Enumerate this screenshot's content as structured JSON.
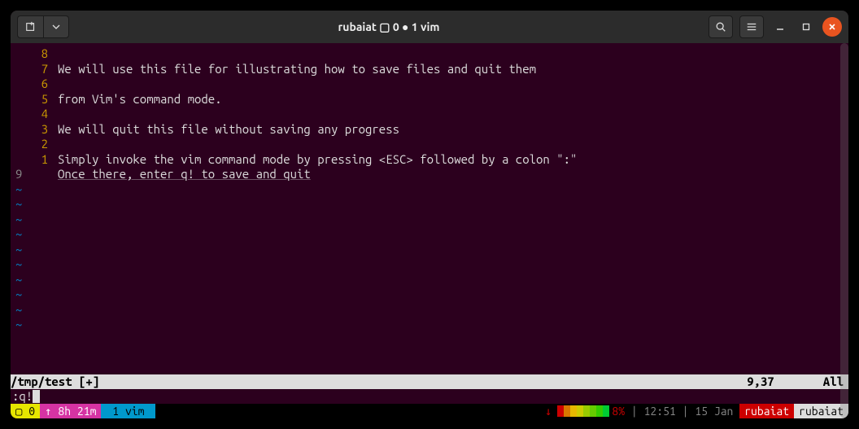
{
  "titlebar": {
    "title": "rubaiat ▢ 0 ● 1 vim"
  },
  "editor": {
    "lines": [
      {
        "num": "8",
        "text": ""
      },
      {
        "num": "7",
        "text": "We will use this file for illustrating how to save files and quit them"
      },
      {
        "num": "6",
        "text": ""
      },
      {
        "num": "5",
        "text": "from Vim's command mode."
      },
      {
        "num": "4",
        "text": ""
      },
      {
        "num": "3",
        "text": "We will quit this file without saving any progress"
      },
      {
        "num": "2",
        "text": ""
      },
      {
        "num": "1",
        "text": "Simply invoke the vim command mode by pressing <ESC> followed by a colon \":\""
      }
    ],
    "current": {
      "num": "9",
      "text": "Once there, enter q! to save and quit"
    },
    "tilde_count": 10
  },
  "statusline": {
    "file": "/tmp/test [+]",
    "position": "9,37",
    "view": "All"
  },
  "cmdline": ":q!",
  "tmux": {
    "session": "▢ 0",
    "uptime": "↑ 8h 21m",
    "window": " 1 vim ",
    "arrow_down": "↓",
    "load_pct": "8%",
    "time": "12:51",
    "date": "15 Jan",
    "host": "rubaiat",
    "user": "rubaiat",
    "sep": " | "
  }
}
